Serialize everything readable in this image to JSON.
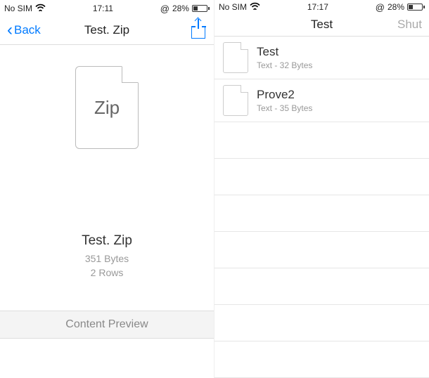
{
  "left": {
    "status": {
      "carrier": "No SIM",
      "time": "17:11",
      "battery_pct": "28%"
    },
    "nav": {
      "back_label": "Back",
      "title": "Test. Zip"
    },
    "file": {
      "type_label": "Zip",
      "name": "Test. Zip",
      "size": "351 Bytes",
      "rows": "2 Rows"
    },
    "section_label": "Content Preview"
  },
  "right": {
    "status": {
      "carrier": "No SIM",
      "time": "17:17",
      "battery_pct": "28%"
    },
    "nav": {
      "title": "Test",
      "right_button": "Shut"
    },
    "items": [
      {
        "title": "Test",
        "subtitle": "Text - 32 Bytes"
      },
      {
        "title": "Prove2",
        "subtitle": "Text - 35 Bytes"
      }
    ]
  }
}
